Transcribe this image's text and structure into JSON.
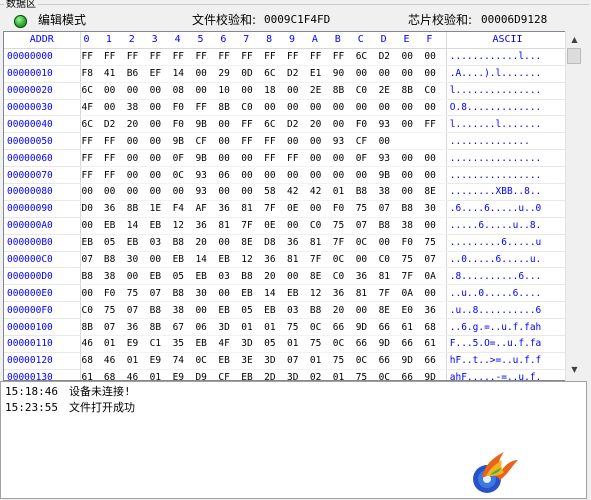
{
  "group": {
    "label": "数据区"
  },
  "toolbar": {
    "mode_label": "编辑模式",
    "file_checksum_label": "文件校验和:",
    "file_checksum_value": "0009C1F4FD",
    "chip_checksum_label": "芯片校验和:",
    "chip_checksum_value": "00006D9128",
    "led_color": "#36b436"
  },
  "hex": {
    "headers": [
      "ADDR",
      "0",
      "1",
      "2",
      "3",
      "4",
      "5",
      "6",
      "7",
      "8",
      "9",
      "A",
      "B",
      "C",
      "D",
      "E",
      "F",
      "ASCII"
    ],
    "rows": [
      {
        "addr": "00000000",
        "bytes": [
          "FF",
          "FF",
          "FF",
          "FF",
          "FF",
          "FF",
          "FF",
          "FF",
          "FF",
          "FF",
          "FF",
          "FF",
          "6C",
          "D2",
          "00",
          "00"
        ],
        "ascii": "............l..."
      },
      {
        "addr": "00000010",
        "bytes": [
          "F8",
          "41",
          "B6",
          "EF",
          "14",
          "00",
          "29",
          "0D",
          "6C",
          "D2",
          "E1",
          "90",
          "00",
          "00",
          "00",
          "00"
        ],
        "ascii": ".A....).l......."
      },
      {
        "addr": "00000020",
        "bytes": [
          "6C",
          "00",
          "00",
          "00",
          "08",
          "00",
          "10",
          "00",
          "18",
          "00",
          "2E",
          "8B",
          "C0",
          "2E",
          "8B",
          "C0"
        ],
        "ascii": "l..............."
      },
      {
        "addr": "00000030",
        "bytes": [
          "4F",
          "00",
          "38",
          "00",
          "F0",
          "FF",
          "8B",
          "C0",
          "00",
          "00",
          "00",
          "00",
          "00",
          "00",
          "00",
          "00"
        ],
        "ascii": "O.8............."
      },
      {
        "addr": "00000040",
        "bytes": [
          "6C",
          "D2",
          "20",
          "00",
          "F0",
          "9B",
          "00",
          "FF",
          "6C",
          "D2",
          "20",
          "00",
          "F0",
          "93",
          "00",
          "FF"
        ],
        "ascii": "l.......l......."
      },
      {
        "addr": "00000050",
        "bytes": [
          "FF",
          "FF",
          "00",
          "00",
          "9B",
          "CF",
          "00",
          "FF",
          "FF",
          "00",
          "00",
          "93",
          "CF",
          "00"
        ],
        "ascii": ".............."
      },
      {
        "addr": "00000060",
        "bytes": [
          "FF",
          "FF",
          "00",
          "00",
          "0F",
          "9B",
          "00",
          "00",
          "FF",
          "FF",
          "00",
          "00",
          "0F",
          "93",
          "00",
          "00"
        ],
        "ascii": "................"
      },
      {
        "addr": "00000070",
        "bytes": [
          "FF",
          "FF",
          "00",
          "00",
          "0C",
          "93",
          "06",
          "00",
          "00",
          "00",
          "00",
          "00",
          "00",
          "9B",
          "00",
          "00"
        ],
        "ascii": "................"
      },
      {
        "addr": "00000080",
        "bytes": [
          "00",
          "00",
          "00",
          "00",
          "00",
          "93",
          "00",
          "00",
          "58",
          "42",
          "42",
          "01",
          "B8",
          "38",
          "00",
          "8E"
        ],
        "ascii": "........XBB..8.."
      },
      {
        "addr": "00000090",
        "bytes": [
          "D0",
          "36",
          "8B",
          "1E",
          "F4",
          "AF",
          "36",
          "81",
          "7F",
          "0E",
          "00",
          "F0",
          "75",
          "07",
          "B8",
          "30"
        ],
        "ascii": ".6....6.....u..0"
      },
      {
        "addr": "000000A0",
        "bytes": [
          "00",
          "EB",
          "14",
          "EB",
          "12",
          "36",
          "81",
          "7F",
          "0E",
          "00",
          "C0",
          "75",
          "07",
          "B8",
          "38",
          "00"
        ],
        "ascii": ".....6.....u..8."
      },
      {
        "addr": "000000B0",
        "bytes": [
          "EB",
          "05",
          "EB",
          "03",
          "B8",
          "20",
          "00",
          "8E",
          "D8",
          "36",
          "81",
          "7F",
          "0C",
          "00",
          "F0",
          "75"
        ],
        "ascii": ".........6.....u"
      },
      {
        "addr": "000000C0",
        "bytes": [
          "07",
          "B8",
          "30",
          "00",
          "EB",
          "14",
          "EB",
          "12",
          "36",
          "81",
          "7F",
          "0C",
          "00",
          "C0",
          "75",
          "07"
        ],
        "ascii": "..0.....6.....u."
      },
      {
        "addr": "000000D0",
        "bytes": [
          "B8",
          "38",
          "00",
          "EB",
          "05",
          "EB",
          "03",
          "B8",
          "20",
          "00",
          "8E",
          "C0",
          "36",
          "81",
          "7F",
          "0A"
        ],
        "ascii": ".8..........6..."
      },
      {
        "addr": "000000E0",
        "bytes": [
          "00",
          "F0",
          "75",
          "07",
          "B8",
          "30",
          "00",
          "EB",
          "14",
          "EB",
          "12",
          "36",
          "81",
          "7F",
          "0A",
          "00"
        ],
        "ascii": "..u..0.....6...."
      },
      {
        "addr": "000000F0",
        "bytes": [
          "C0",
          "75",
          "07",
          "B8",
          "38",
          "00",
          "EB",
          "05",
          "EB",
          "03",
          "B8",
          "20",
          "00",
          "8E",
          "E0",
          "36"
        ],
        "ascii": ".u..8..........6"
      },
      {
        "addr": "00000100",
        "bytes": [
          "8B",
          "07",
          "36",
          "8B",
          "67",
          "06",
          "3D",
          "01",
          "01",
          "75",
          "0C",
          "66",
          "9D",
          "66",
          "61",
          "68"
        ],
        "ascii": "..6.g.=..u.f.fah"
      },
      {
        "addr": "00000110",
        "bytes": [
          "46",
          "01",
          "E9",
          "C1",
          "35",
          "EB",
          "4F",
          "3D",
          "05",
          "01",
          "75",
          "0C",
          "66",
          "9D",
          "66",
          "61"
        ],
        "ascii": "F...5.O=..u.f.fa"
      },
      {
        "addr": "00000120",
        "bytes": [
          "68",
          "46",
          "01",
          "E9",
          "74",
          "0C",
          "EB",
          "3E",
          "3D",
          "07",
          "01",
          "75",
          "0C",
          "66",
          "9D",
          "66"
        ],
        "ascii": "hF..t..>=..u.f.f"
      },
      {
        "addr": "00000130",
        "bytes": [
          "61",
          "68",
          "46",
          "01",
          "E9",
          "D9",
          "CF",
          "EB",
          "2D",
          "3D",
          "02",
          "01",
          "75",
          "0C",
          "66",
          "9D"
        ],
        "ascii": "ahF.....-=..u.f."
      }
    ]
  },
  "log": {
    "lines": [
      {
        "time": "15:18:46",
        "message": "设备未连接!"
      },
      {
        "time": "15:23:55",
        "message": "文件打开成功"
      }
    ]
  },
  "icons": {
    "logo": "app-logo",
    "scroll_up": "up-arrow-icon",
    "scroll_down": "down-arrow-icon"
  }
}
